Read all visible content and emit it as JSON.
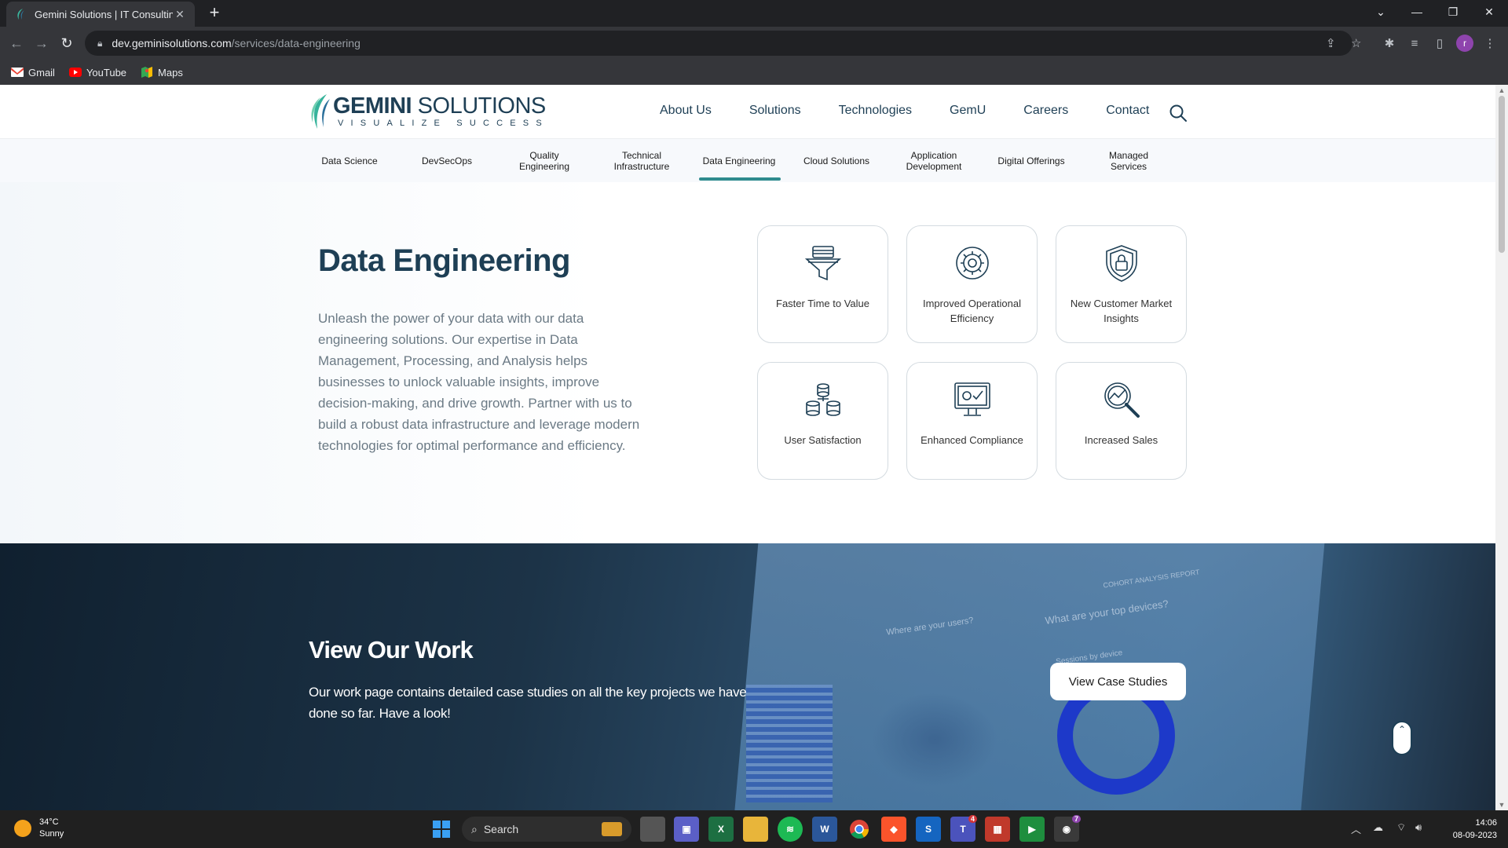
{
  "browser": {
    "tab_title": "Gemini Solutions | IT Consulting,",
    "close_tab": "✕",
    "new_tab": "+",
    "url_host": "dev.geminisolutions.com",
    "url_path": "/services/data-engineering",
    "profile_initial": "r",
    "bookmarks": [
      {
        "label": "Gmail",
        "icon": "gmail-icon"
      },
      {
        "label": "YouTube",
        "icon": "youtube-icon"
      },
      {
        "label": "Maps",
        "icon": "maps-icon"
      }
    ]
  },
  "header": {
    "logo_word1": "GEMINI",
    "logo_word2": " SOLUTIONS",
    "logo_tagline": "VISUALIZE SUCCESS",
    "nav": [
      "About Us",
      "Solutions",
      "Technologies",
      "GemU",
      "Careers",
      "Contact"
    ]
  },
  "subnav": {
    "items": [
      "Data Science",
      "DevSecOps",
      "Quality Engineering",
      "Technical Infrastructure",
      "Data Engineering",
      "Cloud Solutions",
      "Application Development",
      "Digital Offerings",
      "Managed Services"
    ],
    "active": "Data Engineering"
  },
  "hero": {
    "title": "Data Engineering",
    "description": "Unleash the power of your data with our data engineering solutions. Our expertise in Data Management, Processing, and Analysis helps businesses to unlock valuable insights, improve decision-making, and drive growth. Partner with us to build a robust data infrastructure and leverage modern technologies for optimal performance and efficiency.",
    "cards": [
      {
        "label": "Faster Time to Value",
        "icon": "funnel-icon"
      },
      {
        "label": "Improved Operational Efficiency",
        "icon": "gear-cycle-icon"
      },
      {
        "label": "New Customer Market Insights",
        "icon": "shield-lock-icon"
      },
      {
        "label": "User Satisfaction",
        "icon": "coin-stack-icon"
      },
      {
        "label": "Enhanced Compliance",
        "icon": "monitor-check-icon"
      },
      {
        "label": "Increased Sales",
        "icon": "magnifier-chart-icon"
      }
    ]
  },
  "work": {
    "title": "View Our Work",
    "description": "Our work page contains detailed case studies on all the key projects we have done so far. Have a look!",
    "cta": "View Case Studies",
    "bg_text_1": "What are your top devices?",
    "bg_text_2": "Where are your users?",
    "bg_text_3": "COHORT ANALYSIS REPORT",
    "bg_text_4": "Sessions by device"
  },
  "taskbar": {
    "temperature": "34°C",
    "condition": "Sunny",
    "search_label": "Search",
    "time": "14:06",
    "date": "08-09-2023",
    "badge_teams": "4",
    "badge_chrome": "7"
  },
  "colors": {
    "brand_navy": "#1e3f55",
    "active_underline": "#2e8b8e",
    "chrome_dark": "#202124"
  }
}
